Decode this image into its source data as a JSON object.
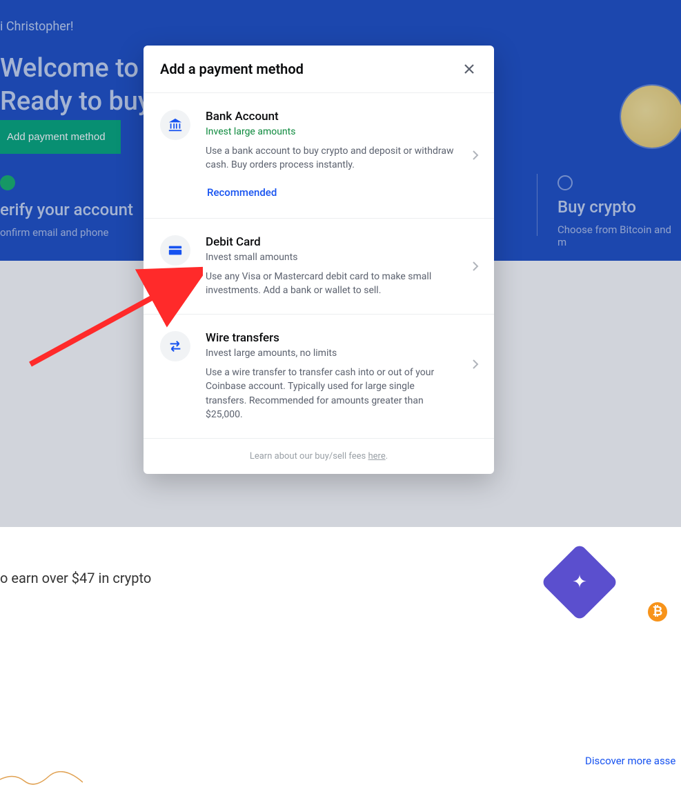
{
  "background": {
    "greeting": "i Christopher!",
    "welcome_line1": "Welcome to Co",
    "welcome_line2": "Ready to buy y",
    "add_payment_button": "Add payment method",
    "verify_title": "erify your account",
    "verify_sub": "onfirm email and phone",
    "buy_title": "Buy crypto",
    "buy_sub": "Choose from Bitcoin and m",
    "earn_text": "o earn over $47 in crypto",
    "discover_link": "Discover more asse",
    "btc_symbol": "₿"
  },
  "modal": {
    "title": "Add a payment method",
    "methods": [
      {
        "id": "bank-account",
        "icon": "bank-icon",
        "title": "Bank Account",
        "subtitle": "Invest large amounts",
        "subtitle_style": "green",
        "description": "Use a bank account to buy crypto and deposit or withdraw cash. Buy orders process instantly.",
        "recommended_label": "Recommended"
      },
      {
        "id": "debit-card",
        "icon": "card-icon",
        "title": "Debit Card",
        "subtitle": "Invest small amounts",
        "subtitle_style": "gray",
        "description": "Use any Visa or Mastercard debit card to make small investments. Add a bank or wallet to sell."
      },
      {
        "id": "wire-transfer",
        "icon": "transfer-icon",
        "title": "Wire transfers",
        "subtitle": "Invest large amounts, no limits",
        "subtitle_style": "gray",
        "description": "Use a wire transfer to transfer cash into or out of your Coinbase account. Typically used for large single transfers. Recommended for amounts greater than $25,000."
      }
    ],
    "footer_prefix": "Learn about our buy/sell fees ",
    "footer_link": "here"
  },
  "colors": {
    "accent_blue": "#1652f0",
    "bg_blue": "#1e4fc4",
    "success_green": "#05a67b",
    "text_gray": "#5b616e"
  }
}
